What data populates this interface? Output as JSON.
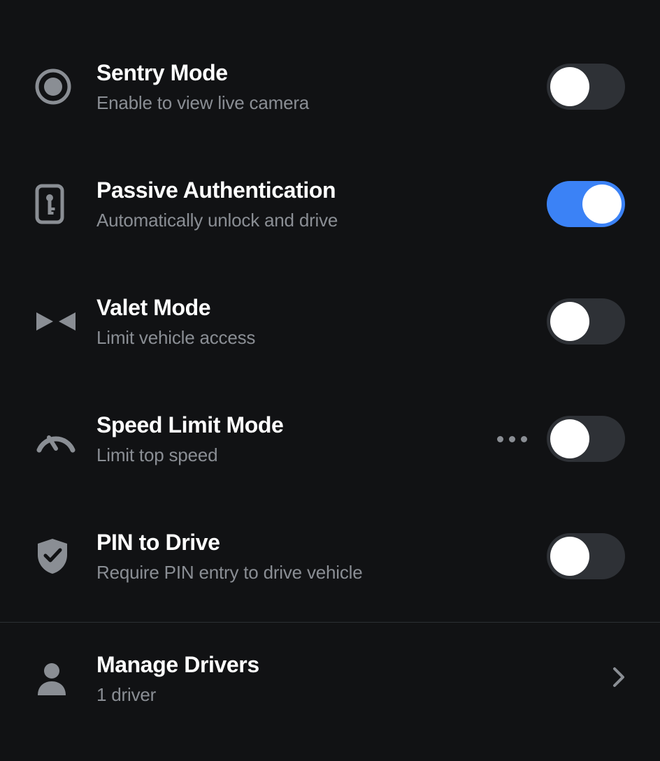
{
  "settings": [
    {
      "key": "sentry",
      "title": "Sentry Mode",
      "subtitle": "Enable to view live camera",
      "on": false,
      "more": false
    },
    {
      "key": "passive",
      "title": "Passive Authentication",
      "subtitle": "Automatically unlock and drive",
      "on": true,
      "more": false
    },
    {
      "key": "valet",
      "title": "Valet Mode",
      "subtitle": "Limit vehicle access",
      "on": false,
      "more": false
    },
    {
      "key": "speed",
      "title": "Speed Limit Mode",
      "subtitle": "Limit top speed",
      "on": false,
      "more": true
    },
    {
      "key": "pin",
      "title": "PIN to Drive",
      "subtitle": "Require PIN entry to drive vehicle",
      "on": false,
      "more": false
    }
  ],
  "manage": {
    "title": "Manage Drivers",
    "subtitle": "1 driver"
  },
  "colors": {
    "accent": "#3b82f6"
  }
}
